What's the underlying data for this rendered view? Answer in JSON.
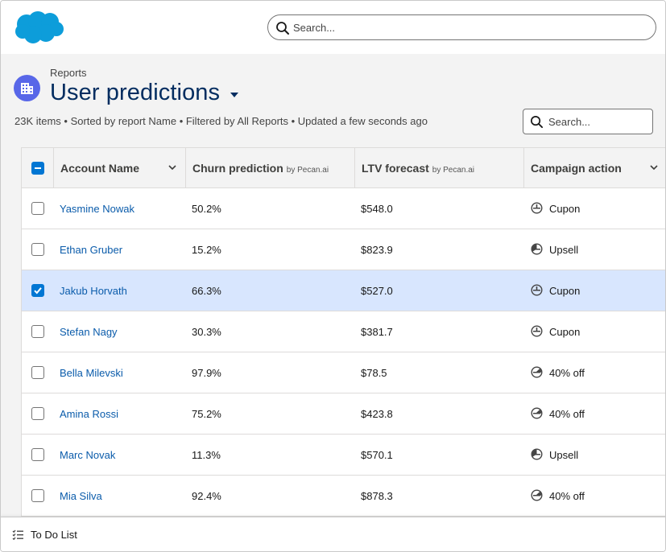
{
  "global_search": {
    "placeholder": "Search..."
  },
  "header": {
    "breadcrumb": "Reports",
    "title": "User predictions",
    "meta": "23K items • Sorted by report Name • Filtered by All Reports • Updated a few seconds ago",
    "search_placeholder": "Search..."
  },
  "table": {
    "columns": [
      {
        "label": "Account Name",
        "by": ""
      },
      {
        "label": "Churn prediction",
        "by": "by Pecan.ai"
      },
      {
        "label": "LTV forecast",
        "by": "by Pecan.ai"
      },
      {
        "label": "Campaign action",
        "by": ""
      }
    ],
    "rows": [
      {
        "name": "Yasmine Nowak",
        "churn": "50.2%",
        "ltv": "$548.0",
        "action": "Cupon",
        "action_icon": "coupon-icon",
        "selected": false
      },
      {
        "name": "Ethan Gruber",
        "churn": "15.2%",
        "ltv": "$823.9",
        "action": "Upsell",
        "action_icon": "upsell-icon",
        "selected": false
      },
      {
        "name": "Jakub Horvath",
        "churn": "66.3%",
        "ltv": "$527.0",
        "action": "Cupon",
        "action_icon": "coupon-icon",
        "selected": true
      },
      {
        "name": "Stefan Nagy",
        "churn": "30.3%",
        "ltv": "$381.7",
        "action": "Cupon",
        "action_icon": "coupon-icon",
        "selected": false
      },
      {
        "name": "Bella Milevski",
        "churn": "97.9%",
        "ltv": "$78.5",
        "action": "40% off",
        "action_icon": "discount-icon",
        "selected": false
      },
      {
        "name": "Amina Rossi",
        "churn": "75.2%",
        "ltv": "$423.8",
        "action": "40% off",
        "action_icon": "discount-icon",
        "selected": false
      },
      {
        "name": "Marc Novak",
        "churn": "11.3%",
        "ltv": "$570.1",
        "action": "Upsell",
        "action_icon": "upsell-icon",
        "selected": false
      },
      {
        "name": "Mia Silva",
        "churn": "92.4%",
        "ltv": "$878.3",
        "action": "40% off",
        "action_icon": "discount-icon",
        "selected": false
      }
    ]
  },
  "footer": {
    "label": "To Do List"
  },
  "colors": {
    "brand_blue": "#0d9dda",
    "title_navy": "#032d60",
    "link_blue": "#0b5cab",
    "selected_row": "#d8e6fe",
    "checkbox_blue": "#0176d3",
    "object_icon": "#5867e8"
  }
}
